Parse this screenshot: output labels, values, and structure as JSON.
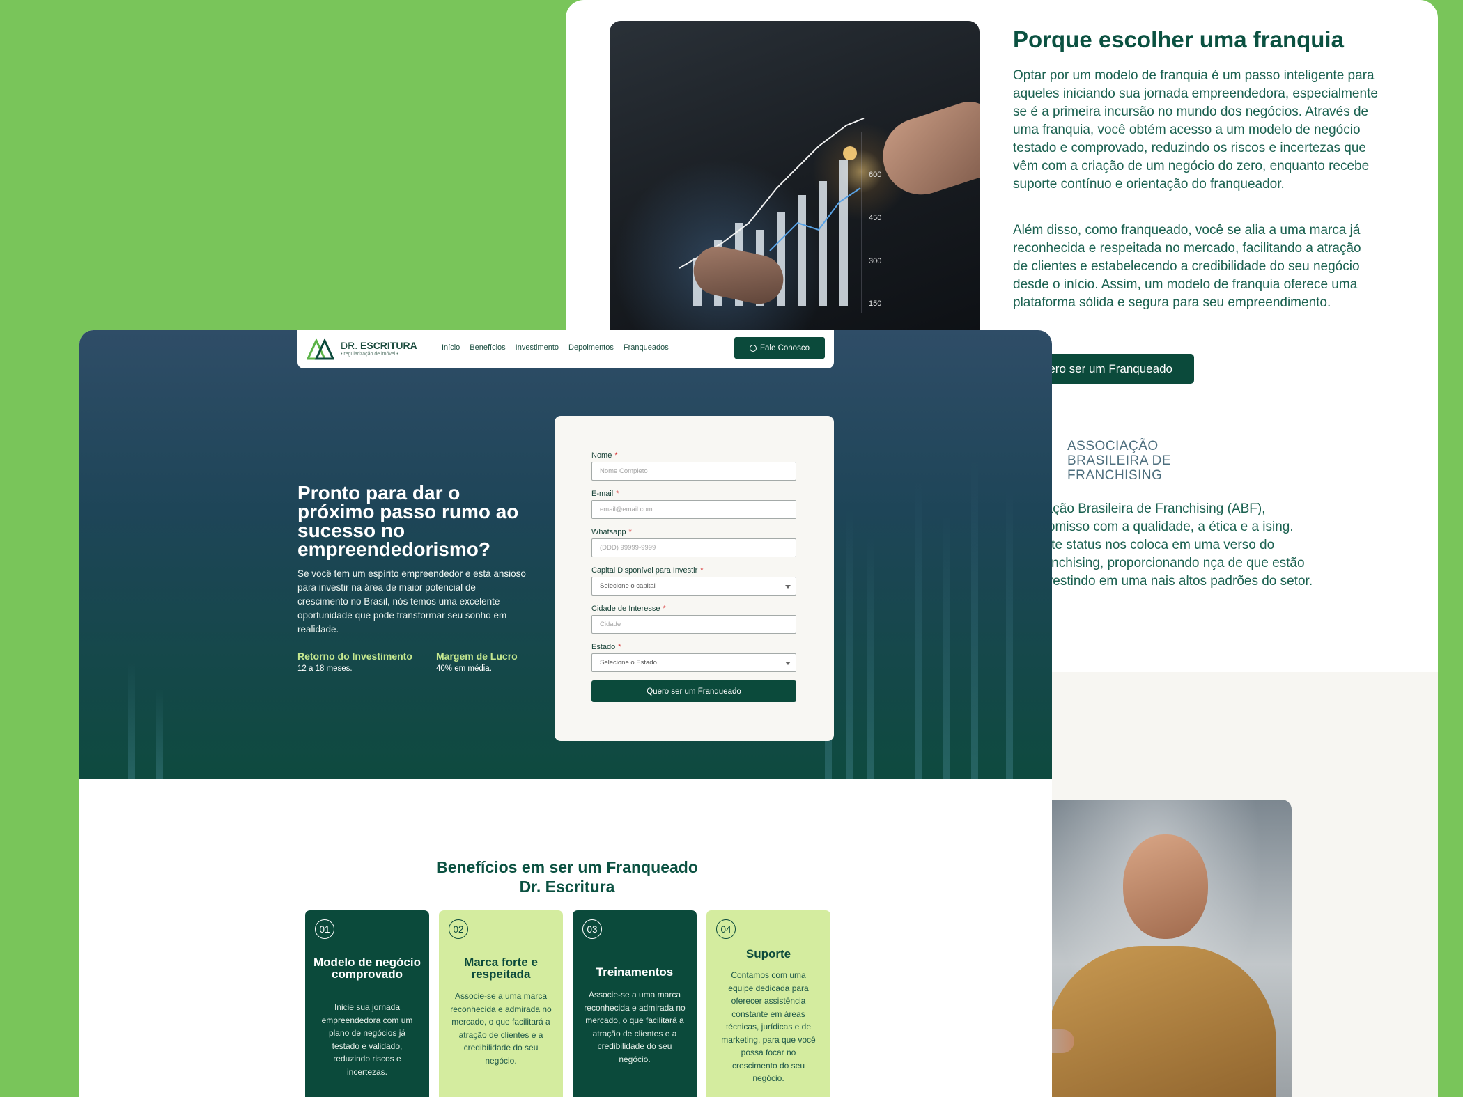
{
  "back_page": {
    "title": "Porque escolher uma franquia",
    "paragraph1": "Optar por um modelo de franquia é um passo inteligente para aqueles iniciando sua jornada empreendedora, especialmente se é a primeira incursão no mundo dos negócios. Através de uma franquia, você obtém acesso a um modelo de negócio testado e comprovado, reduzindo os riscos e incertezas que vêm com a criação de um negócio do zero, enquanto recebe suporte contínuo e orientação do franqueador.",
    "paragraph2": "Além disso, como franqueado, você se alia a uma marca já reconhecida e respeitada no mercado, facilitando a atração de clientes e estabelecendo a credibilidade do seu negócio desde o início. Assim, um modelo de franquia oferece uma plataforma sólida e segura para seu empreendimento.",
    "cta_label": "ero ser um Franqueado",
    "abf_line1": "ASSOCIAÇÃO",
    "abf_line2": "BRASILEIRA DE",
    "abf_line3": "FRANCHISING",
    "abf_text": "ciação Brasileira de Franchising (ABF), promisso com a qualidade, a ética e a ising. Este status nos coloca em uma verso do franchising, proporcionando nça de que estão investindo em uma nais altos padrões do setor.",
    "chart_ticks": [
      "600",
      "450",
      "300",
      "150"
    ]
  },
  "nav": {
    "logo_dr": "DR.",
    "logo_name": "ESCRITURA",
    "logo_tagline": "• regularização de imóvel •",
    "links": [
      "Início",
      "Benefícios",
      "Investimento",
      "Depoimentos",
      "Franqueados"
    ],
    "cta": "Fale Conosco"
  },
  "hero": {
    "heading": "Pronto para dar o próximo passo rumo ao sucesso no empreendedorismo?",
    "text": "Se você tem um espírito empreendedor e está ansioso para investir na área de maior potencial de crescimento no Brasil, nós temos uma excelente oportunidade que pode transformar seu sonho em realidade.",
    "stat1_label": "Retorno do Investimento",
    "stat1_value": "12 a 18 meses.",
    "stat2_label": "Margem de Lucro",
    "stat2_value": "40% em média."
  },
  "form": {
    "name_label": "Nome",
    "name_placeholder": "Nome Completo",
    "email_label": "E-mail",
    "email_placeholder": "email@email.com",
    "whatsapp_label": "Whatsapp",
    "whatsapp_placeholder": "(DDD) 99999-9999",
    "capital_label": "Capital Disponível para Investir",
    "capital_value": "Selecione o capital",
    "city_label": "Cidade de Interesse",
    "city_placeholder": "Cidade",
    "state_label": "Estado",
    "state_value": "Selecione o Estado",
    "required_mark": "*",
    "submit": "Quero ser um Franqueado"
  },
  "benefits": {
    "title_line1": "Benefícios em ser um Franqueado",
    "title_line2": "Dr. Escritura",
    "cards": [
      {
        "num": "01",
        "title": "Modelo de negócio comprovado",
        "text": "Inicie sua jornada empreendedora com um plano de negócios já testado e validado, reduzindo riscos e incertezas."
      },
      {
        "num": "02",
        "title": "Marca forte e respeitada",
        "text": "Associe-se a uma marca reconhecida e admirada no mercado, o que facilitará a atração de clientes e a credibilidade do seu negócio."
      },
      {
        "num": "03",
        "title": "Treinamentos",
        "text": "Associe-se a uma marca reconhecida e admirada no mercado, o que facilitará a atração de clientes e a credibilidade do seu negócio."
      },
      {
        "num": "04",
        "title": "Suporte",
        "text": "Contamos com uma equipe dedicada para oferecer assistência constante em áreas técnicas, jurídicas e de marketing, para que você possa focar no crescimento do seu negócio."
      }
    ]
  },
  "colors": {
    "background": "#79c55a",
    "brand_dark": "#0b4a3b",
    "brand_light": "#d4ec9f",
    "required": "#d93838"
  }
}
